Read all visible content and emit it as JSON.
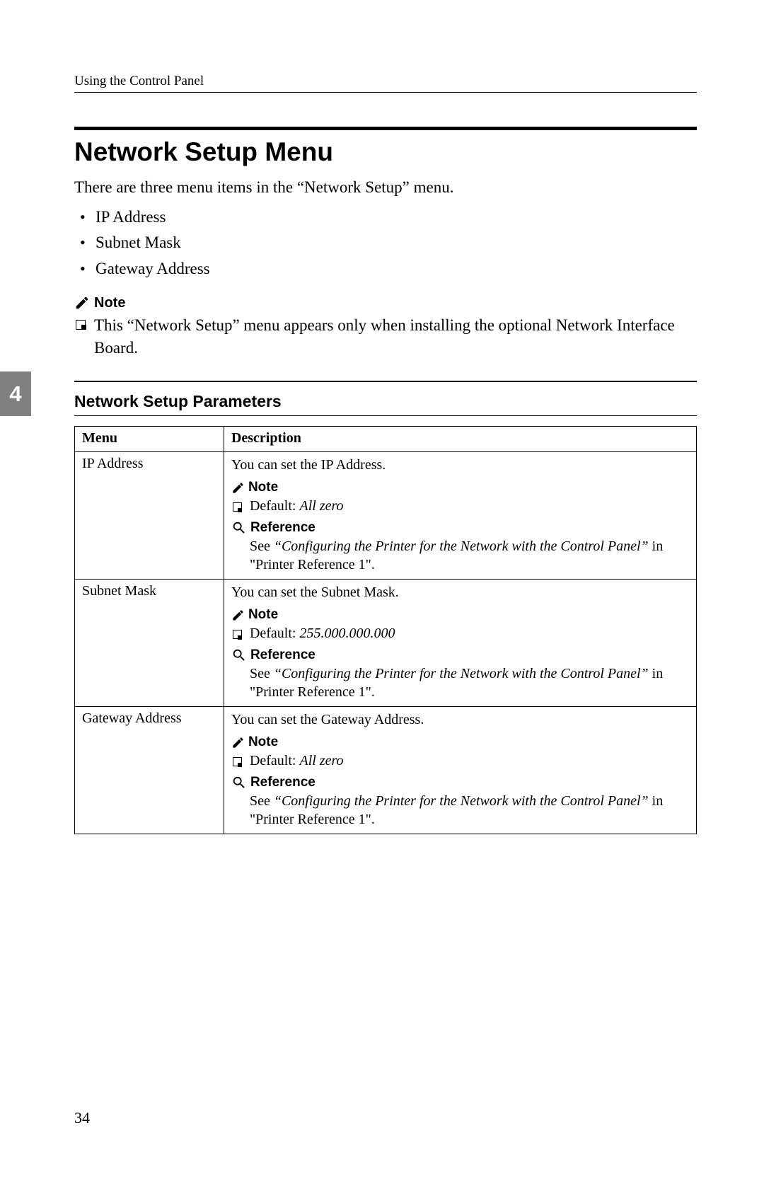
{
  "header": {
    "running_title": "Using the Control Panel"
  },
  "chapter_tab": "4",
  "section": {
    "title": "Network Setup Menu",
    "intro": "There are three menu items in the “Network Setup” menu.",
    "items": [
      "IP Address",
      "Subnet Mask",
      "Gateway Address"
    ],
    "note_label": "Note",
    "note_text": "This “Network Setup” menu appears only when installing the optional Network Interface Board."
  },
  "subsection": {
    "title": "Network Setup Parameters"
  },
  "table": {
    "headers": {
      "menu": "Menu",
      "desc": "Description"
    },
    "note_label": "Note",
    "ref_label": "Reference",
    "rows": [
      {
        "menu": "IP Address",
        "desc": "You can set the IP Address.",
        "default_prefix": "Default: ",
        "default_val": "All zero",
        "ref_see": "See ",
        "ref_title": "“Configuring the Printer for the Network with the Control Panel”",
        "ref_in": " in \"Printer Reference 1\"."
      },
      {
        "menu": "Subnet Mask",
        "desc": "You can set the Subnet Mask.",
        "default_prefix": "Default: ",
        "default_val": "255.000.000.000",
        "ref_see": "See ",
        "ref_title": "“Configuring the Printer for the Network with the Control Panel”",
        "ref_in": " in \"Printer Reference 1\"."
      },
      {
        "menu": "Gateway Address",
        "desc": "You can set the Gateway Address.",
        "default_prefix": "Default: ",
        "default_val": "All zero",
        "ref_see": "See ",
        "ref_title": "“Configuring the Printer for the Network with the Control Panel”",
        "ref_in": " in \"Printer Reference 1\"."
      }
    ]
  },
  "page_number": "34"
}
